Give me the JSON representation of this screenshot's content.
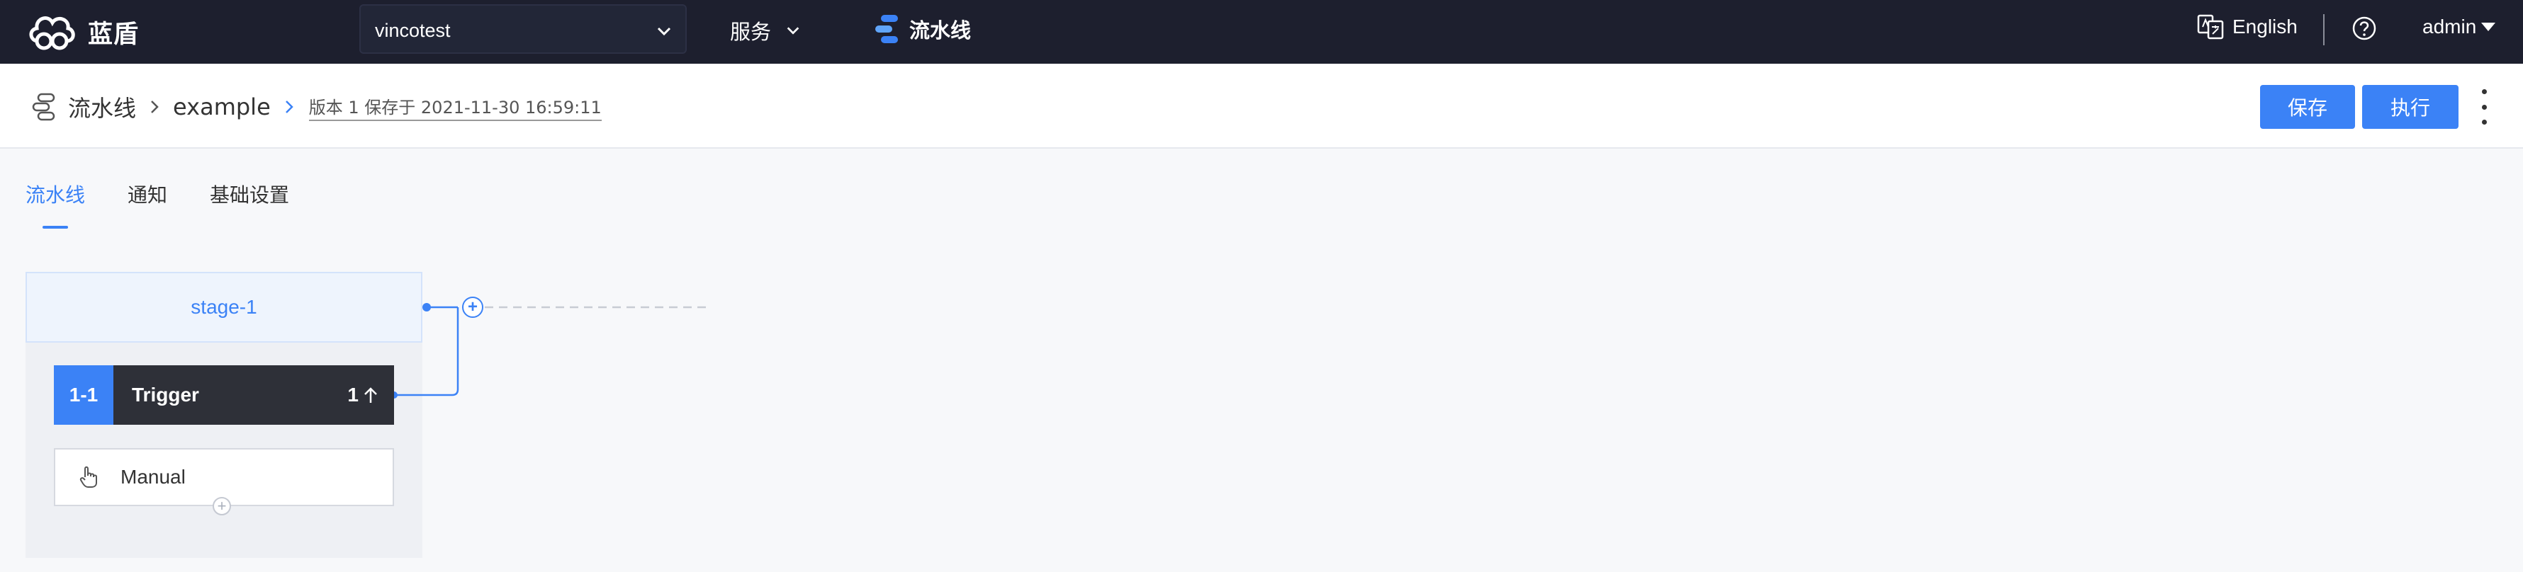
{
  "brand": {
    "name": "蓝盾",
    "color": "#3b82f6",
    "nav_bg": "#1d1f2e"
  },
  "topnav": {
    "project_select": {
      "value": "vincotest",
      "icon": "chevron-down-icon"
    },
    "services_label": "服务",
    "pipeline_label": "流水线",
    "language_label": "English",
    "help_icon": "question-circle-icon",
    "user_label": "admin"
  },
  "header": {
    "breadcrumb": [
      "流水线",
      "example"
    ],
    "version_info": "版本 1 保存于 2021-11-30 16:59:11",
    "save_label": "保存",
    "run_label": "执行"
  },
  "tabs": [
    {
      "label": "流水线",
      "active": true
    },
    {
      "label": "通知",
      "active": false
    },
    {
      "label": "基础设置",
      "active": false
    }
  ],
  "pipeline": {
    "stage": {
      "name": "stage-1"
    },
    "job": {
      "index": "1-1",
      "name": "Trigger",
      "count": "1"
    },
    "step": {
      "name": "Manual",
      "icon": "hand-pointer-icon"
    }
  }
}
